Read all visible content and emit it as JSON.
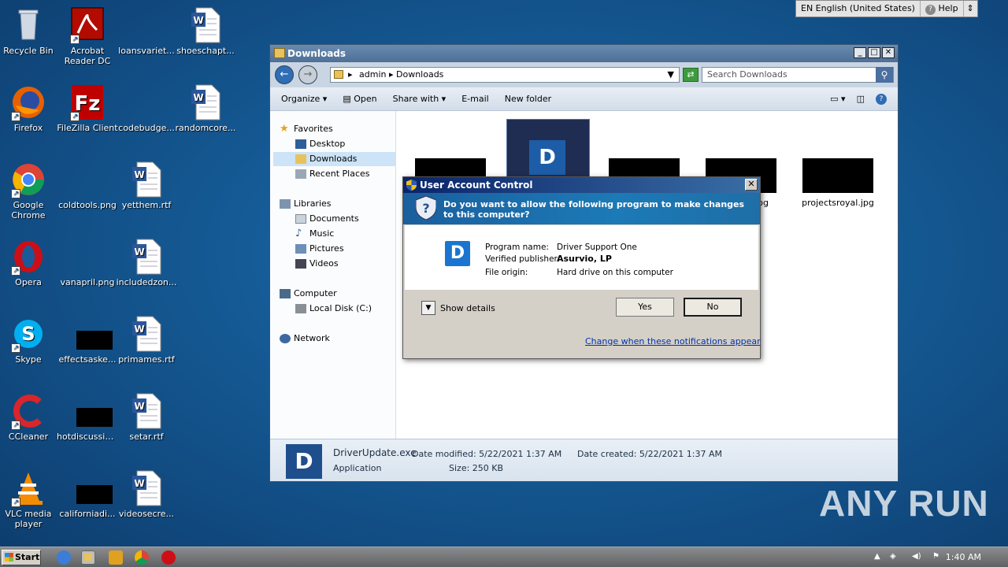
{
  "desktop": {
    "icons": [
      {
        "label": "Recycle Bin"
      },
      {
        "label": "Acrobat Reader DC"
      },
      {
        "label": "loansvariet..."
      },
      {
        "label": "shoeschapt..."
      },
      {
        "label": "Firefox"
      },
      {
        "label": "FileZilla Client"
      },
      {
        "label": "codebudge..."
      },
      {
        "label": "randomcore..."
      },
      {
        "label": "Google Chrome"
      },
      {
        "label": "coldtools.png"
      },
      {
        "label": "yetthem.rtf"
      },
      {
        "label": "Opera"
      },
      {
        "label": "vanapril.png"
      },
      {
        "label": "includedzon..."
      },
      {
        "label": "Skype"
      },
      {
        "label": "effectsaske..."
      },
      {
        "label": "primames.rtf"
      },
      {
        "label": "CCleaner"
      },
      {
        "label": "hotdiscussio..."
      },
      {
        "label": "setar.rtf"
      },
      {
        "label": "VLC media player"
      },
      {
        "label": "californiadi..."
      },
      {
        "label": "videosecre..."
      }
    ]
  },
  "explorer": {
    "title": "Downloads",
    "address": {
      "crumb1": "admin",
      "crumb2": "Downloads"
    },
    "search_placeholder": "Search Downloads",
    "toolbar": {
      "organize": "Organize",
      "open": "Open",
      "share_with": "Share with",
      "email": "E-mail",
      "new_folder": "New folder"
    },
    "nav": {
      "favorites": "Favorites",
      "desktop": "Desktop",
      "downloads": "Downloads",
      "recent_places": "Recent Places",
      "libraries": "Libraries",
      "documents": "Documents",
      "music": "Music",
      "pictures": "Pictures",
      "videos": "Videos",
      "computer": "Computer",
      "local_disk": "Local Disk (C:)",
      "network": "Network"
    },
    "files": {
      "partial_jpg": "jpg",
      "projectsroyal": "projectsroyal.jpg"
    },
    "details": {
      "filename": "DriverUpdate.exe",
      "date_modified": "Date modified: 5/22/2021 1:37 AM",
      "date_created": "Date created: 5/22/2021 1:37 AM",
      "type": "Application",
      "size": "Size: 250 KB"
    }
  },
  "uac": {
    "title": "User Account Control",
    "question": "Do you want to allow the following program to make changes to this computer?",
    "program_name_label": "Program name:",
    "program_name": "Driver Support One",
    "publisher_label": "Verified publisher:",
    "publisher": "Asurvio, LP",
    "origin_label": "File origin:",
    "origin": "Hard drive on this computer",
    "show_details": "Show details",
    "yes": "Yes",
    "no": "No",
    "change_link": "Change when these notifications appear"
  },
  "langbar": {
    "language": "EN English (United States)",
    "help": "Help"
  },
  "taskbar": {
    "start": "Start",
    "clock": "1:40 AM"
  },
  "watermark": "ANY RUN"
}
